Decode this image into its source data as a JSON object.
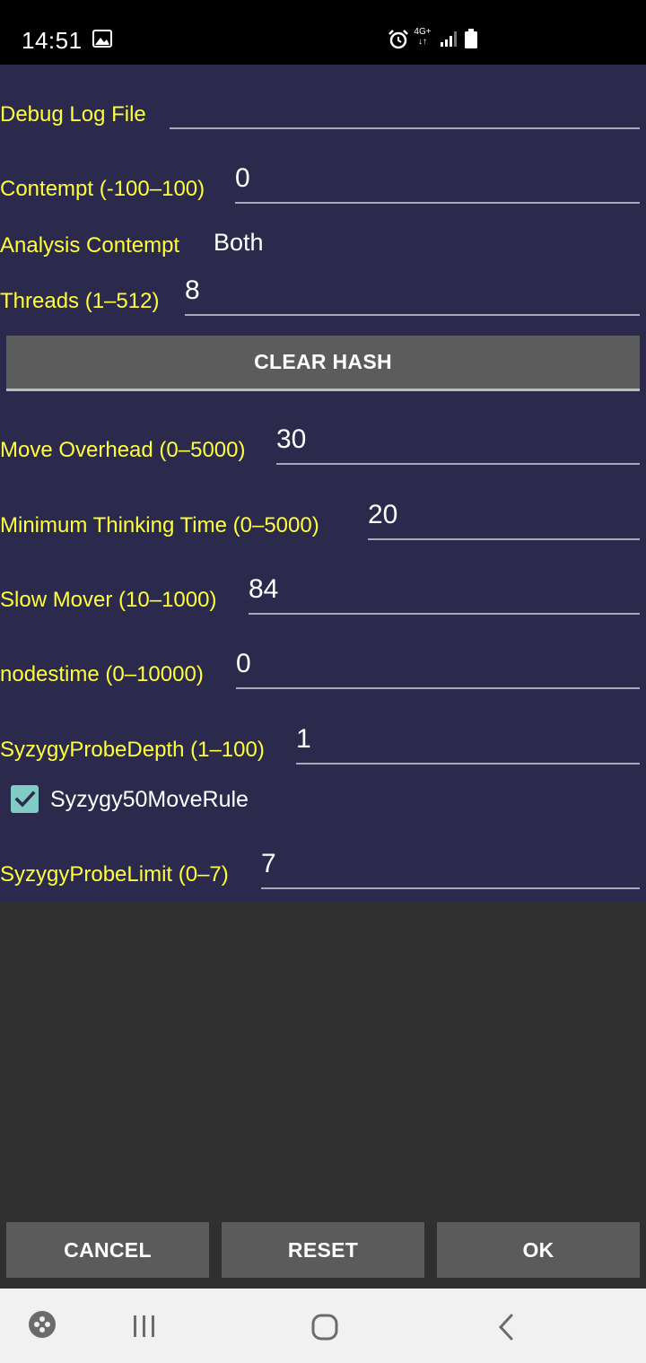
{
  "status_bar": {
    "time": "14:51",
    "network_label_top": "4G+",
    "network_label_bottom": "↓↑",
    "icons": [
      "gallery-icon",
      "alarm-icon",
      "signal-icon",
      "battery-icon"
    ]
  },
  "options": {
    "debug_log_file": {
      "label": "Debug Log File",
      "value": ""
    },
    "contempt": {
      "label": "Contempt (-100–100)",
      "value": "0"
    },
    "analysis_contempt": {
      "label": "Analysis Contempt",
      "value": "Both"
    },
    "threads": {
      "label": "Threads (1–512)",
      "value": "8"
    },
    "clear_hash_label": "CLEAR HASH",
    "move_overhead": {
      "label": "Move Overhead (0–5000)",
      "value": "30"
    },
    "min_thinking_time": {
      "label": "Minimum Thinking Time (0–5000)",
      "value": "20"
    },
    "slow_mover": {
      "label": "Slow Mover (10–1000)",
      "value": "84"
    },
    "nodestime": {
      "label": "nodestime (0–10000)",
      "value": "0"
    },
    "syzygy_probe_depth": {
      "label": "SyzygyProbeDepth (1–100)",
      "value": "1"
    },
    "syzygy_50_move_rule": {
      "label": "Syzygy50MoveRule",
      "checked": true
    },
    "syzygy_probe_limit": {
      "label": "SyzygyProbeLimit (0–7)",
      "value": "7"
    }
  },
  "buttons": {
    "cancel": "CANCEL",
    "reset": "RESET",
    "ok": "OK"
  },
  "nav_bar": {
    "icons": [
      "game-launcher-icon",
      "recent-apps-icon",
      "home-icon",
      "back-icon"
    ]
  },
  "colors": {
    "panel_background": "#2b2a4c",
    "label_yellow": "#ffff3b",
    "button_gray": "#5b5b5b",
    "checkbox_teal": "#80cbc4",
    "dialog_background": "#303030"
  }
}
